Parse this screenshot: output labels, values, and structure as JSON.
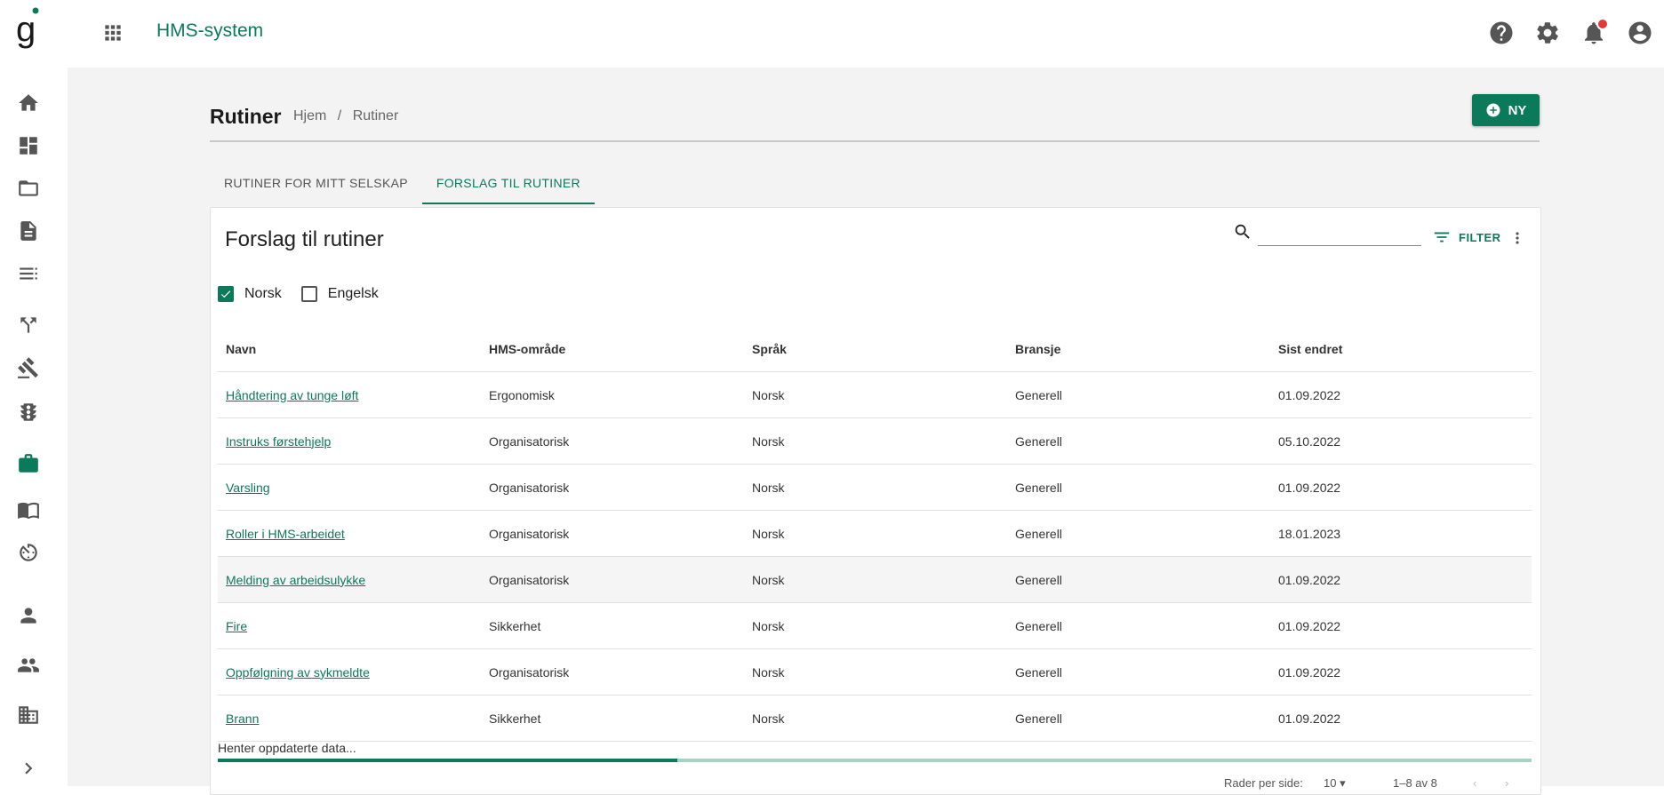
{
  "app": {
    "logo_letter": "g",
    "title": "HMS-system"
  },
  "sidebar": {
    "items": [
      {
        "icon": "home-icon"
      },
      {
        "icon": "dashboard-icon"
      },
      {
        "icon": "folder-icon"
      },
      {
        "icon": "document-icon"
      },
      {
        "icon": "list-icon"
      },
      {
        "icon": "merge-icon"
      },
      {
        "icon": "gavel-icon"
      },
      {
        "icon": "traffic-light-icon"
      },
      {
        "icon": "briefcase-icon",
        "active": true
      },
      {
        "icon": "book-icon"
      },
      {
        "icon": "timer-icon"
      },
      {
        "icon": "person-icon"
      },
      {
        "icon": "group-icon"
      },
      {
        "icon": "building-icon"
      },
      {
        "icon": "chevron-right-icon"
      }
    ]
  },
  "header": {
    "page_title": "Rutiner",
    "breadcrumb": [
      "Hjem",
      "/",
      "Rutiner"
    ],
    "new_button": "NY"
  },
  "tabs": [
    {
      "label": "RUTINER FOR MITT SELSKAP",
      "active": false
    },
    {
      "label": "FORSLAG TIL RUTINER",
      "active": true
    }
  ],
  "card": {
    "title": "Forslag til rutiner",
    "search": {
      "value": "",
      "placeholder": ""
    },
    "filter_label": "FILTER",
    "languages": [
      {
        "label": "Norsk",
        "checked": true
      },
      {
        "label": "Engelsk",
        "checked": false
      }
    ]
  },
  "table": {
    "columns": [
      "Navn",
      "HMS-område",
      "Språk",
      "Bransje",
      "Sist endret"
    ],
    "rows": [
      [
        "Håndtering av tunge løft",
        "Ergonomisk",
        "Norsk",
        "Generell",
        "01.09.2022"
      ],
      [
        "Instruks førstehjelp",
        "Organisatorisk",
        "Norsk",
        "Generell",
        "05.10.2022"
      ],
      [
        "Varsling",
        "Organisatorisk",
        "Norsk",
        "Generell",
        "01.09.2022"
      ],
      [
        "Roller i HMS-arbeidet",
        "Organisatorisk",
        "Norsk",
        "Generell",
        "18.01.2023"
      ],
      [
        "Melding av arbeidsulykke",
        "Organisatorisk",
        "Norsk",
        "Generell",
        "01.09.2022"
      ],
      [
        "Fire",
        "Sikkerhet",
        "Norsk",
        "Generell",
        "01.09.2022"
      ],
      [
        "Oppfølgning av sykmeldte",
        "Organisatorisk",
        "Norsk",
        "Generell",
        "01.09.2022"
      ],
      [
        "Brann",
        "Sikkerhet",
        "Norsk",
        "Generell",
        "01.09.2022"
      ]
    ]
  },
  "status": {
    "loading_text": "Henter oppdaterte data...",
    "progress_fraction": 0.35
  },
  "pager": {
    "rows_per_page_label": "Rader per side:",
    "rows_per_page": "10",
    "range": "1–8 av 8"
  },
  "colors": {
    "accent": "#0b7a5a",
    "notification": "#e53935",
    "background": "#f3f3f3"
  }
}
